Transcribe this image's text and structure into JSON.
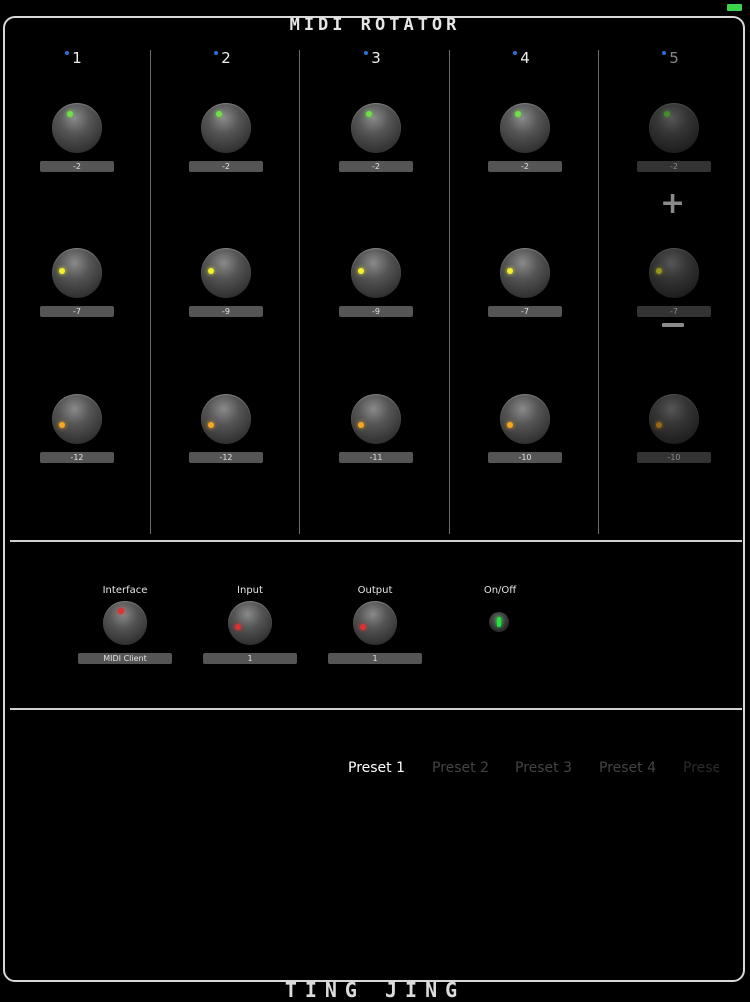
{
  "app_title": "MIDI ROTATOR",
  "footer_title": "TING JING",
  "status": {
    "battery_color": "#3ad34b"
  },
  "columns": [
    {
      "number": "1",
      "knobs": [
        {
          "value": "-2",
          "indicator_color": "#6fe049"
        },
        {
          "value": "-7",
          "indicator_color": "#f3f02c"
        },
        {
          "value": "-12",
          "indicator_color": "#f5a623"
        }
      ]
    },
    {
      "number": "2",
      "knobs": [
        {
          "value": "-2",
          "indicator_color": "#6fe049"
        },
        {
          "value": "-9",
          "indicator_color": "#f3f02c"
        },
        {
          "value": "-12",
          "indicator_color": "#f5a623"
        }
      ]
    },
    {
      "number": "3",
      "knobs": [
        {
          "value": "-2",
          "indicator_color": "#6fe049"
        },
        {
          "value": "-9",
          "indicator_color": "#f3f02c"
        },
        {
          "value": "-11",
          "indicator_color": "#f5a623"
        }
      ]
    },
    {
      "number": "4",
      "knobs": [
        {
          "value": "-2",
          "indicator_color": "#6fe049"
        },
        {
          "value": "-7",
          "indicator_color": "#f3f02c"
        },
        {
          "value": "-10",
          "indicator_color": "#f5a623"
        }
      ]
    },
    {
      "number": "5",
      "knobs": [
        {
          "value": "-2",
          "indicator_color": "#6fe049"
        },
        {
          "value": "-7",
          "indicator_color": "#f3f02c"
        },
        {
          "value": "-10",
          "indicator_color": "#f5a623"
        }
      ]
    }
  ],
  "plus_symbol": "+",
  "controls": {
    "interface": {
      "label": "Interface",
      "value": "MIDI Client"
    },
    "input": {
      "label": "Input",
      "value": "1"
    },
    "output": {
      "label": "Output",
      "value": "1"
    },
    "onoff": {
      "label": "On/Off"
    },
    "indicator_color": "#e03030"
  },
  "presets": [
    {
      "label": "Preset 1",
      "active": true
    },
    {
      "label": "Preset 2",
      "active": false
    },
    {
      "label": "Preset 3",
      "active": false
    },
    {
      "label": "Preset 4",
      "active": false
    },
    {
      "label": "Prese",
      "active": false
    }
  ],
  "colors": {
    "preset_active": "#ffffff",
    "preset_inactive": "#444444",
    "midi_dot": "#2a6fd6"
  }
}
